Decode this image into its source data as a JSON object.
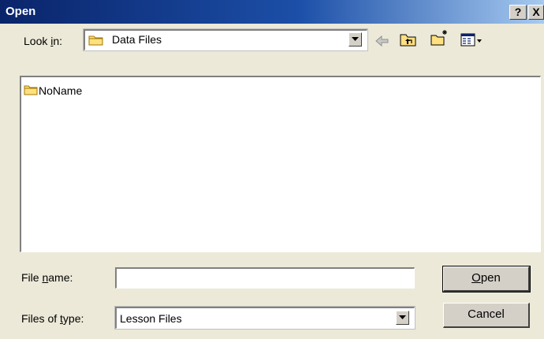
{
  "window": {
    "title": "Open",
    "help_label": "?",
    "close_label": "X"
  },
  "look_in": {
    "label_pre": "Look ",
    "label_mnemonic": "i",
    "label_post": "n:",
    "value": "Data Files",
    "icon": "folder-icon"
  },
  "toolbar": {
    "back_icon": "back-arrow-icon",
    "up_icon": "up-one-level-icon",
    "new_folder_icon": "create-new-folder-icon",
    "view_menu_icon": "view-menu-icon"
  },
  "files": [
    {
      "name": "NoName",
      "icon": "folder-icon"
    }
  ],
  "file_name": {
    "label_pre": "File ",
    "label_mnemonic": "n",
    "label_post": "ame:",
    "value": ""
  },
  "files_of_type": {
    "label_pre": "Files of ",
    "label_mnemonic": "t",
    "label_post": "ype:",
    "value": "Lesson Files"
  },
  "buttons": {
    "open_mnemonic": "O",
    "open_rest": "pen",
    "cancel": "Cancel"
  },
  "colors": {
    "dialog_bg": "#ece9d8",
    "titlebar_start": "#0a246a",
    "titlebar_end": "#a6caf0",
    "folder_fill": "#ffe080",
    "folder_stroke": "#a07800"
  }
}
